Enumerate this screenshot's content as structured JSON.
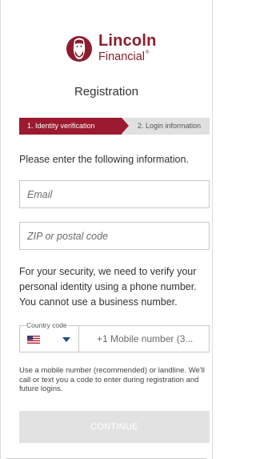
{
  "brand": {
    "name_line1": "Lincoln",
    "name_line2": "Financial",
    "trademark": "®",
    "color": "#8c1d2c"
  },
  "page": {
    "title": "Registration"
  },
  "stepper": {
    "steps": [
      {
        "label": "1. Identity verification",
        "active": true
      },
      {
        "label": "2. Login information",
        "active": false
      }
    ],
    "active_color": "#9b1a2f",
    "inactive_color": "#e0e0e0"
  },
  "form": {
    "instructions": "Please enter the following information.",
    "email": {
      "placeholder": "Email",
      "value": ""
    },
    "zip": {
      "placeholder": "ZIP or postal code",
      "value": ""
    },
    "security_text": "For your security, we need to verify your personal identity using a phone number. You cannot use a business number.",
    "country_code": {
      "legend": "Country code",
      "selected": "US",
      "flag_icon": "us-flag-icon"
    },
    "mobile": {
      "placeholder": "+1 Mobile number (3...",
      "value": ""
    },
    "hint": "Use a mobile number (recommended) or landline. We'll call or text you a code to enter during registration and future logins.",
    "continue_label": "CONTINUE",
    "continue_disabled": true
  }
}
